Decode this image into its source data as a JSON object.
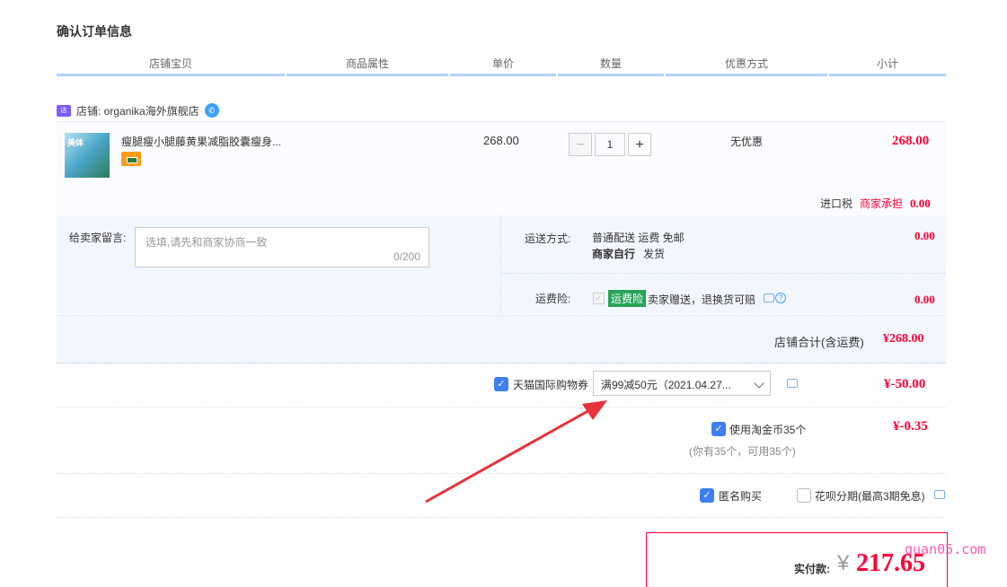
{
  "page": {
    "title": "确认订单信息"
  },
  "headers": [
    "店铺宝贝",
    "商品属性",
    "单价",
    "数量",
    "优惠方式",
    "小计"
  ],
  "shop": {
    "label": "店铺: organika海外旗舰店"
  },
  "item": {
    "name": "瘦腿瘦小腿藤黄果减脂胶囊瘦身...",
    "thumb_text": "美体",
    "price": "268.00",
    "quantity": "1",
    "qty_minus": "−",
    "qty_plus": "+",
    "promotion": "无优惠",
    "subtotal": "268.00",
    "tax_label": "进口税",
    "tax_merchant": "商家承担",
    "tax_value": "0.00"
  },
  "message": {
    "label": "给卖家留言:",
    "placeholder": "选填,请先和商家协商一致",
    "count": "0/200"
  },
  "shipping": {
    "label": "运送方式:",
    "method_line1": "普通配送 运费 免邮",
    "method_line2_bold": "商家自行",
    "method_line2": "发货",
    "value": "0.00",
    "insurance_label": "运费险:",
    "insurance_tag": "运费险",
    "insurance_desc": "卖家赠送，退换货可赔",
    "insurance_value": "0.00"
  },
  "shop_total": {
    "label": "店铺合计(含运费)",
    "value": "¥268.00"
  },
  "coupon": {
    "label": "天猫国际购物券",
    "selected": "满99减50元（2021.04.27...",
    "value": "¥-50.00"
  },
  "coins": {
    "label": "使用淘金币35个",
    "note": "(你有35个，可用35个)",
    "value": "¥-0.35"
  },
  "options": {
    "anonymous": "匿名购买",
    "huabei": "花呗分期(最高3期免息)"
  },
  "payment": {
    "label": "实付款:",
    "currency": "¥",
    "amount": "217.65"
  },
  "watermark": "quan05.com",
  "colors": {
    "accent_red": "#ff0036",
    "checkbox_blue": "#3d7ef0",
    "header_line": "#b2d1ff",
    "arrow": "#e8313a"
  }
}
